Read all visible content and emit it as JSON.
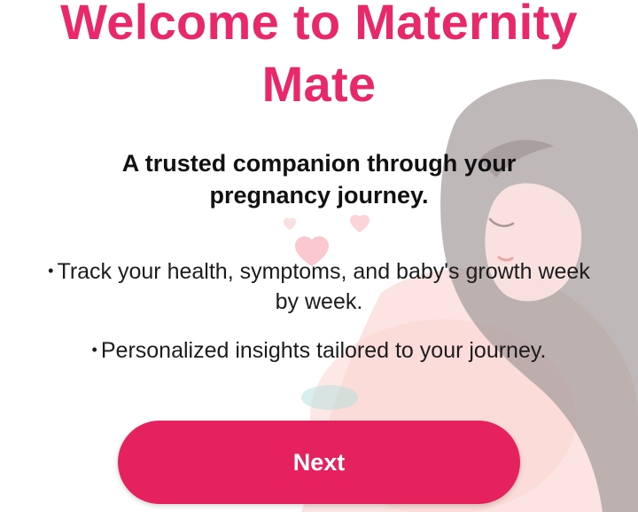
{
  "onboarding": {
    "title": "Welcome to Maternity Mate",
    "subtitle": "A trusted companion through your pregnancy journey.",
    "bullets": [
      "Track your health, symptoms, and baby's growth week by week.",
      "Personalized insights tailored to your journey."
    ],
    "bullet_marker": "•",
    "next_label": "Next"
  },
  "colors": {
    "accent": "#e8286a",
    "button": "#e5215e",
    "text": "#111111",
    "background": "#ffffff"
  },
  "icons": {
    "illustration": "pregnant-woman-illustration",
    "hearts": "heart-icon"
  }
}
